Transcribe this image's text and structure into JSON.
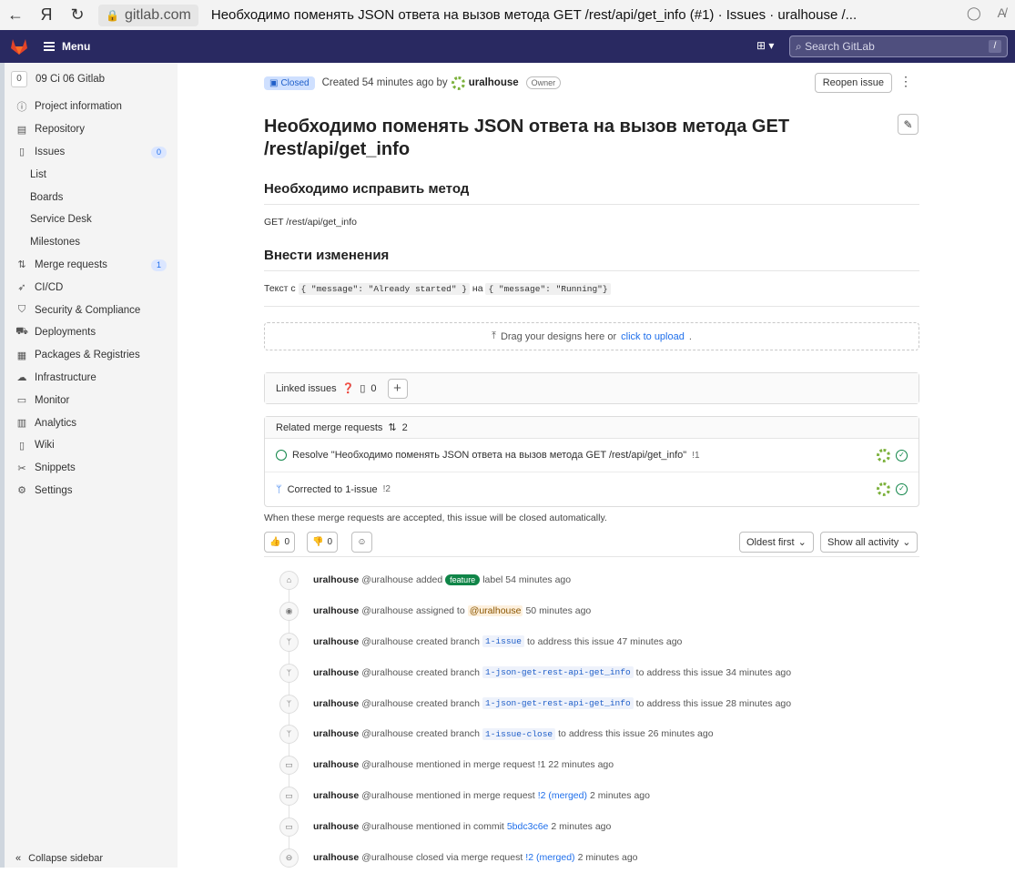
{
  "browser": {
    "back_icon": "←",
    "yandex_icon": "Я",
    "reload_icon": "↻",
    "domain": "gitlab.com",
    "tab_title": "Необходимо поменять JSON ответа на вызов метода GET /rest/api/get_info (#1) · Issues · uralhouse /..."
  },
  "header": {
    "menu_label": "Menu",
    "search_placeholder": "Search GitLab",
    "search_shortcut": "/"
  },
  "sidebar": {
    "project_avatar": "0",
    "project_name": "09 Ci 06 Gitlab",
    "items": [
      {
        "label": "Project information",
        "icon": "info-icon"
      },
      {
        "label": "Repository",
        "icon": "repository-icon"
      },
      {
        "label": "Issues",
        "icon": "issues-icon",
        "count": "0"
      },
      {
        "label": "List",
        "sub": true
      },
      {
        "label": "Boards",
        "sub": true
      },
      {
        "label": "Service Desk",
        "sub": true
      },
      {
        "label": "Milestones",
        "sub": true
      },
      {
        "label": "Merge requests",
        "icon": "merge-request-icon",
        "count": "1"
      },
      {
        "label": "CI/CD",
        "icon": "rocket-icon"
      },
      {
        "label": "Security & Compliance",
        "icon": "shield-icon"
      },
      {
        "label": "Deployments",
        "icon": "deployments-icon"
      },
      {
        "label": "Packages & Registries",
        "icon": "package-icon"
      },
      {
        "label": "Infrastructure",
        "icon": "cloud-icon"
      },
      {
        "label": "Monitor",
        "icon": "monitor-icon"
      },
      {
        "label": "Analytics",
        "icon": "chart-icon"
      },
      {
        "label": "Wiki",
        "icon": "book-icon"
      },
      {
        "label": "Snippets",
        "icon": "scissors-icon"
      },
      {
        "label": "Settings",
        "icon": "gear-icon"
      }
    ],
    "collapse_label": "Collapse sidebar"
  },
  "issue": {
    "status": "Closed",
    "created_prefix": "Created 54 minutes ago by",
    "author": "uralhouse",
    "role": "Owner",
    "reopen_label": "Reopen issue",
    "title": "Необходимо поменять JSON ответа на вызов метода GET /rest/api/get_info",
    "heading1": "Необходимо исправить метод",
    "para1": "GET /rest/api/get_info",
    "heading2": "Внести изменения",
    "para2_prefix": "Текст с",
    "code_old": "{ \"message\": \"Already started\" }",
    "para2_mid": "на",
    "code_new": "{ \"message\": \"Running\"}",
    "upload_text": "Drag your designs here or",
    "upload_link": "click to upload",
    "upload_suffix": "."
  },
  "linked": {
    "title": "Linked issues",
    "count": "0"
  },
  "related_mrs": {
    "title": "Related merge requests",
    "count": "2",
    "rows": [
      {
        "title": "Resolve \"Необходимо поменять JSON ответа на вызов метода GET /rest/api/get_info\"",
        "ref": "!1"
      },
      {
        "title": "Corrected to 1-issue",
        "ref": "!2"
      }
    ],
    "note": "When these merge requests are accepted, this issue will be closed automatically."
  },
  "reactions": {
    "thumbs_up": "0",
    "thumbs_down": "0",
    "sort_label": "Oldest first",
    "filter_label": "Show all activity"
  },
  "activity": [
    {
      "icon": "tag-icon",
      "user": "uralhouse",
      "handle": "@uralhouse",
      "pre": "added",
      "label": "feature",
      "post": "label 54 minutes ago"
    },
    {
      "icon": "user-icon",
      "user": "uralhouse",
      "handle": "@uralhouse",
      "pre": "assigned to",
      "mention": "@uralhouse",
      "post": "50 minutes ago"
    },
    {
      "icon": "branch-icon",
      "user": "uralhouse",
      "handle": "@uralhouse",
      "pre": "created branch",
      "code": "1-issue",
      "post": "to address this issue 47 minutes ago"
    },
    {
      "icon": "branch-icon",
      "user": "uralhouse",
      "handle": "@uralhouse",
      "pre": "created branch",
      "code": "1-json-get-rest-api-get_info",
      "post": "to address this issue 34 minutes ago"
    },
    {
      "icon": "branch-icon",
      "user": "uralhouse",
      "handle": "@uralhouse",
      "pre": "created branch",
      "code": "1-json-get-rest-api-get_info",
      "post": "to address this issue 28 minutes ago"
    },
    {
      "icon": "branch-icon",
      "user": "uralhouse",
      "handle": "@uralhouse",
      "pre": "created branch",
      "code": "1-issue-close",
      "post": "to address this issue 26 minutes ago"
    },
    {
      "icon": "comment-icon",
      "user": "uralhouse",
      "handle": "@uralhouse",
      "pre": "mentioned in merge request !1 22 minutes ago"
    },
    {
      "icon": "comment-icon",
      "user": "uralhouse",
      "handle": "@uralhouse",
      "pre": "mentioned in merge request",
      "link": "!2 (merged)",
      "post": "2 minutes ago"
    },
    {
      "icon": "comment-icon",
      "user": "uralhouse",
      "handle": "@uralhouse",
      "pre": "mentioned in commit",
      "link": "5bdc3c6e",
      "post": "2 minutes ago"
    },
    {
      "icon": "closed-icon",
      "user": "uralhouse",
      "handle": "@uralhouse",
      "pre": "closed via merge request",
      "link": "!2 (merged)",
      "post": "2 minutes ago"
    }
  ]
}
